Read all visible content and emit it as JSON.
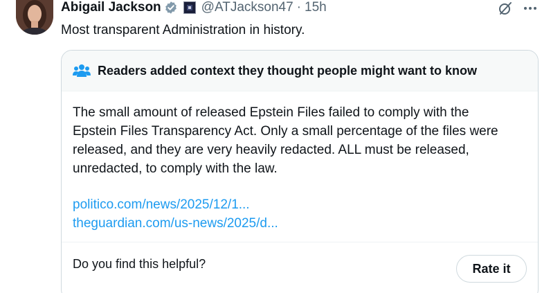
{
  "author": {
    "name": "Abigail Jackson",
    "handle": "@ATJackson47",
    "separator": "·",
    "time": "15h",
    "verified_icon": "verified-badge-icon",
    "affiliation_icon": "affiliation-badge-icon"
  },
  "tweet": {
    "text": "Most transparent Administration in history."
  },
  "actions": {
    "grok_icon": "grok-icon",
    "more_icon": "more-options-icon"
  },
  "community_note": {
    "header_icon": "people-icon",
    "title": "Readers added context they thought people might want to know",
    "body": "The small amount of released Epstein Files failed to comply with the Epstein Files Transparency Act. Only a small percentage of the files were released, and they are very heavily redacted. ALL must be released, unredacted, to comply with the law.",
    "links": [
      "politico.com/news/2025/12/1...",
      "theguardian.com/us-news/2025/d..."
    ],
    "helpful_prompt": "Do you find this helpful?",
    "rate_button": "Rate it"
  },
  "colors": {
    "link": "#1d9bf0",
    "secondary_text": "#536471",
    "border": "#cfd9de",
    "note_header_bg": "#f7f9f9"
  }
}
